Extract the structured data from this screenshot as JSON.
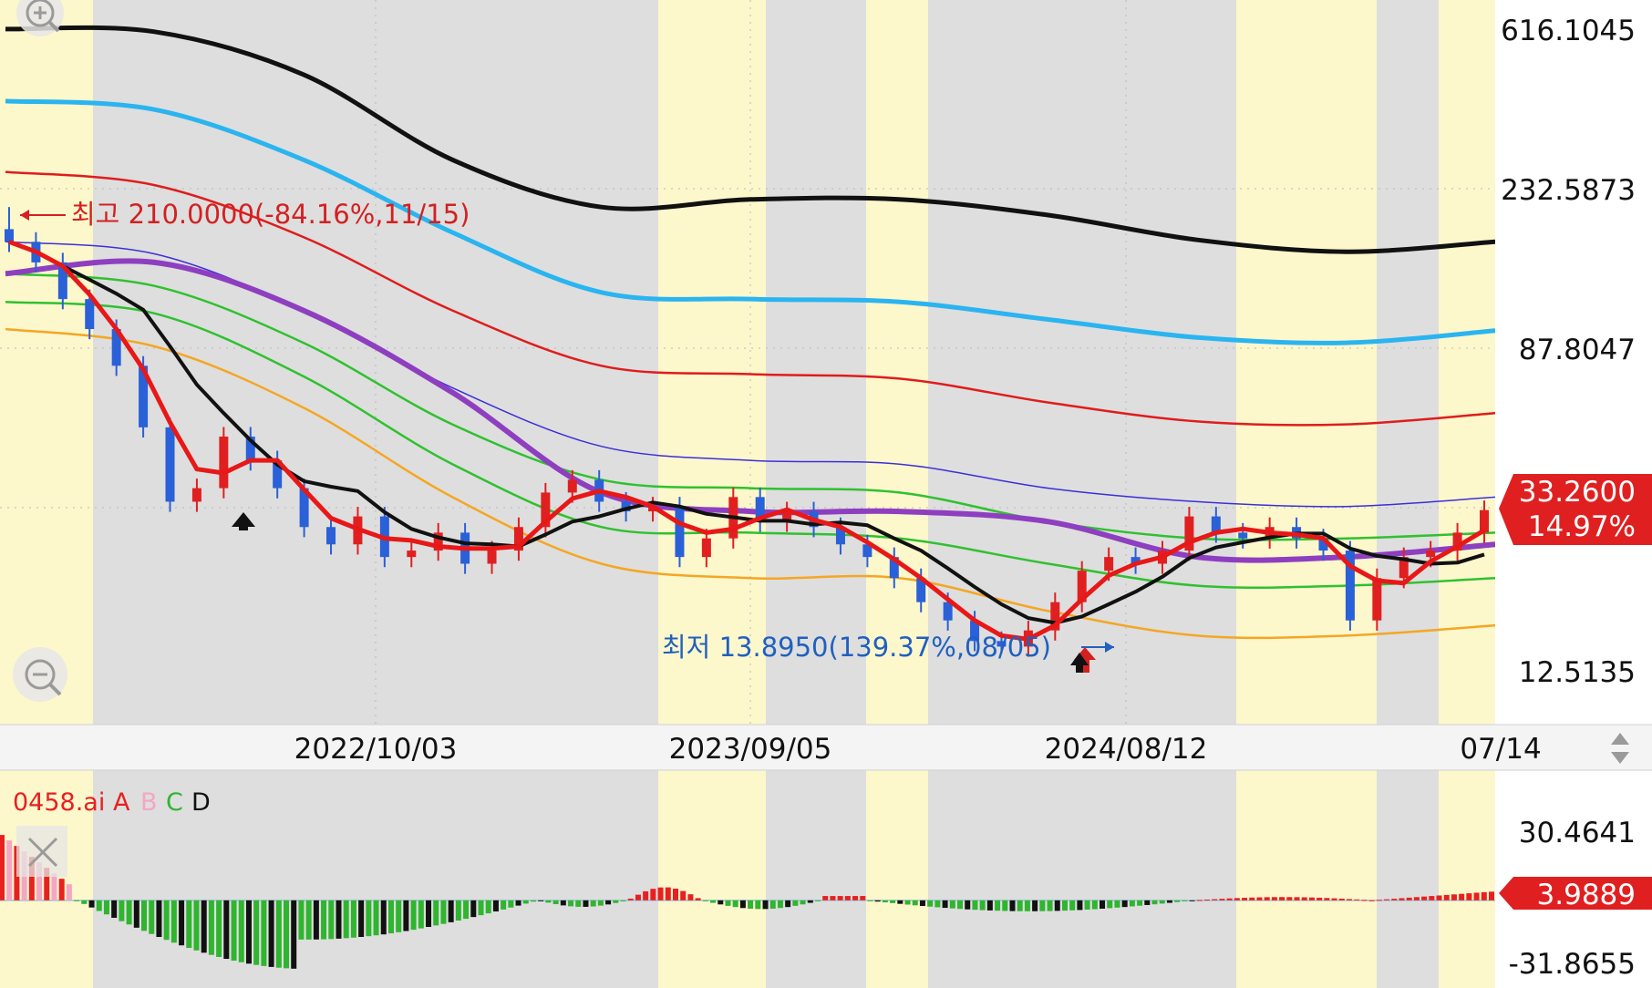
{
  "upper_axis": {
    "labels": [
      "616.1045",
      "232.5873",
      "87.8047",
      "12.5135"
    ]
  },
  "lower_axis": {
    "labels": [
      "30.4641",
      "-31.8655"
    ]
  },
  "date_axis": {
    "labels": [
      "2022/10/03",
      "2023/09/05",
      "2024/08/12",
      "07/14"
    ]
  },
  "current_price": {
    "price": "33.2600",
    "change": "14.97%",
    "color": "#e02020"
  },
  "current_indicator": {
    "value": "3.9889",
    "color": "#e02020"
  },
  "annotations": {
    "high": "최고 210.0000(-84.16%,11/15)",
    "low": "최저 13.8950(139.37%,08/05)"
  },
  "legend": {
    "name": "0458.ai",
    "items": [
      {
        "label": "A",
        "color": "#e82020"
      },
      {
        "label": "B",
        "color": "#f4a6c4"
      },
      {
        "label": "C",
        "color": "#2fb52f"
      },
      {
        "label": "D",
        "color": "#111111"
      }
    ]
  },
  "colors": {
    "band_black": "#111111",
    "band_cyan": "#2ab4f0",
    "band_red": "#e01c1c",
    "band_blue": "#3b2fd8",
    "band_green": "#2fc12f",
    "band_orange": "#f5a623",
    "center_purple": "#8e3fc0",
    "ma_red": "#e81818",
    "ma_black": "#111111",
    "candle_up": "#e02020",
    "candle_down": "#2a60d8",
    "zone_yellow": "#fdf7cc",
    "zone_gray": "#dedede"
  },
  "icons": [
    "zoom-in-icon",
    "zoom-out-icon",
    "close-icon",
    "scroll-arrows-icon",
    "arrow-up-icon"
  ],
  "chart_data": {
    "type": "line",
    "scale": "log",
    "ylim": [
      11,
      700
    ],
    "x_dates": [
      "2021/11/15",
      "2022/10/03",
      "2023/09/05",
      "2024/08/05",
      "2024/08/12",
      "2025/07/14"
    ],
    "series": [
      {
        "values": [
          620,
          610,
          470,
          280,
          210,
          220,
          220,
          200,
          172,
          160,
          170
        ]
      },
      {
        "values": [
          400,
          380,
          280,
          180,
          125,
          120,
          118,
          106,
          95,
          92,
          99
        ]
      },
      {
        "values": [
          260,
          240,
          175,
          112,
          80,
          76,
          74,
          64,
          57,
          56,
          60
        ]
      },
      {
        "values": [
          170,
          158,
          112,
          70,
          49,
          45,
          44,
          38,
          35,
          34,
          36
        ]
      },
      {
        "values": [
          140,
          130,
          92,
          56,
          40,
          38,
          37,
          31,
          28,
          28,
          29
        ]
      },
      {
        "values": [
          118,
          110,
          75,
          44,
          30,
          29,
          28,
          24,
          21,
          21,
          22
        ]
      },
      {
        "values": [
          100,
          90,
          62,
          36,
          24,
          22,
          22,
          18,
          15.5,
          15.5,
          16.5
        ]
      },
      {
        "values": [
          140,
          150,
          112,
          68,
          37,
          33,
          33,
          31,
          25,
          25,
          27
        ]
      }
    ],
    "price_candles": {
      "close": [
        170,
        150,
        120,
        100,
        80,
        55,
        35,
        38,
        52,
        45,
        38,
        30,
        27,
        32,
        25,
        26,
        29,
        24,
        26,
        30,
        37,
        40,
        35,
        33,
        34,
        25,
        28,
        36,
        31,
        33,
        30,
        27,
        25,
        22,
        19,
        17,
        15,
        14.5,
        16,
        19,
        23,
        25,
        24,
        26,
        32,
        29,
        28,
        30,
        28,
        26,
        17,
        22,
        25,
        26,
        29,
        33.26
      ],
      "high": 210.0,
      "low": 13.895,
      "last": 33.26,
      "last_change_pct": 14.97
    },
    "indicator": {
      "ylim": [
        -31.8655,
        30.4641
      ],
      "last": 3.9889
    }
  }
}
